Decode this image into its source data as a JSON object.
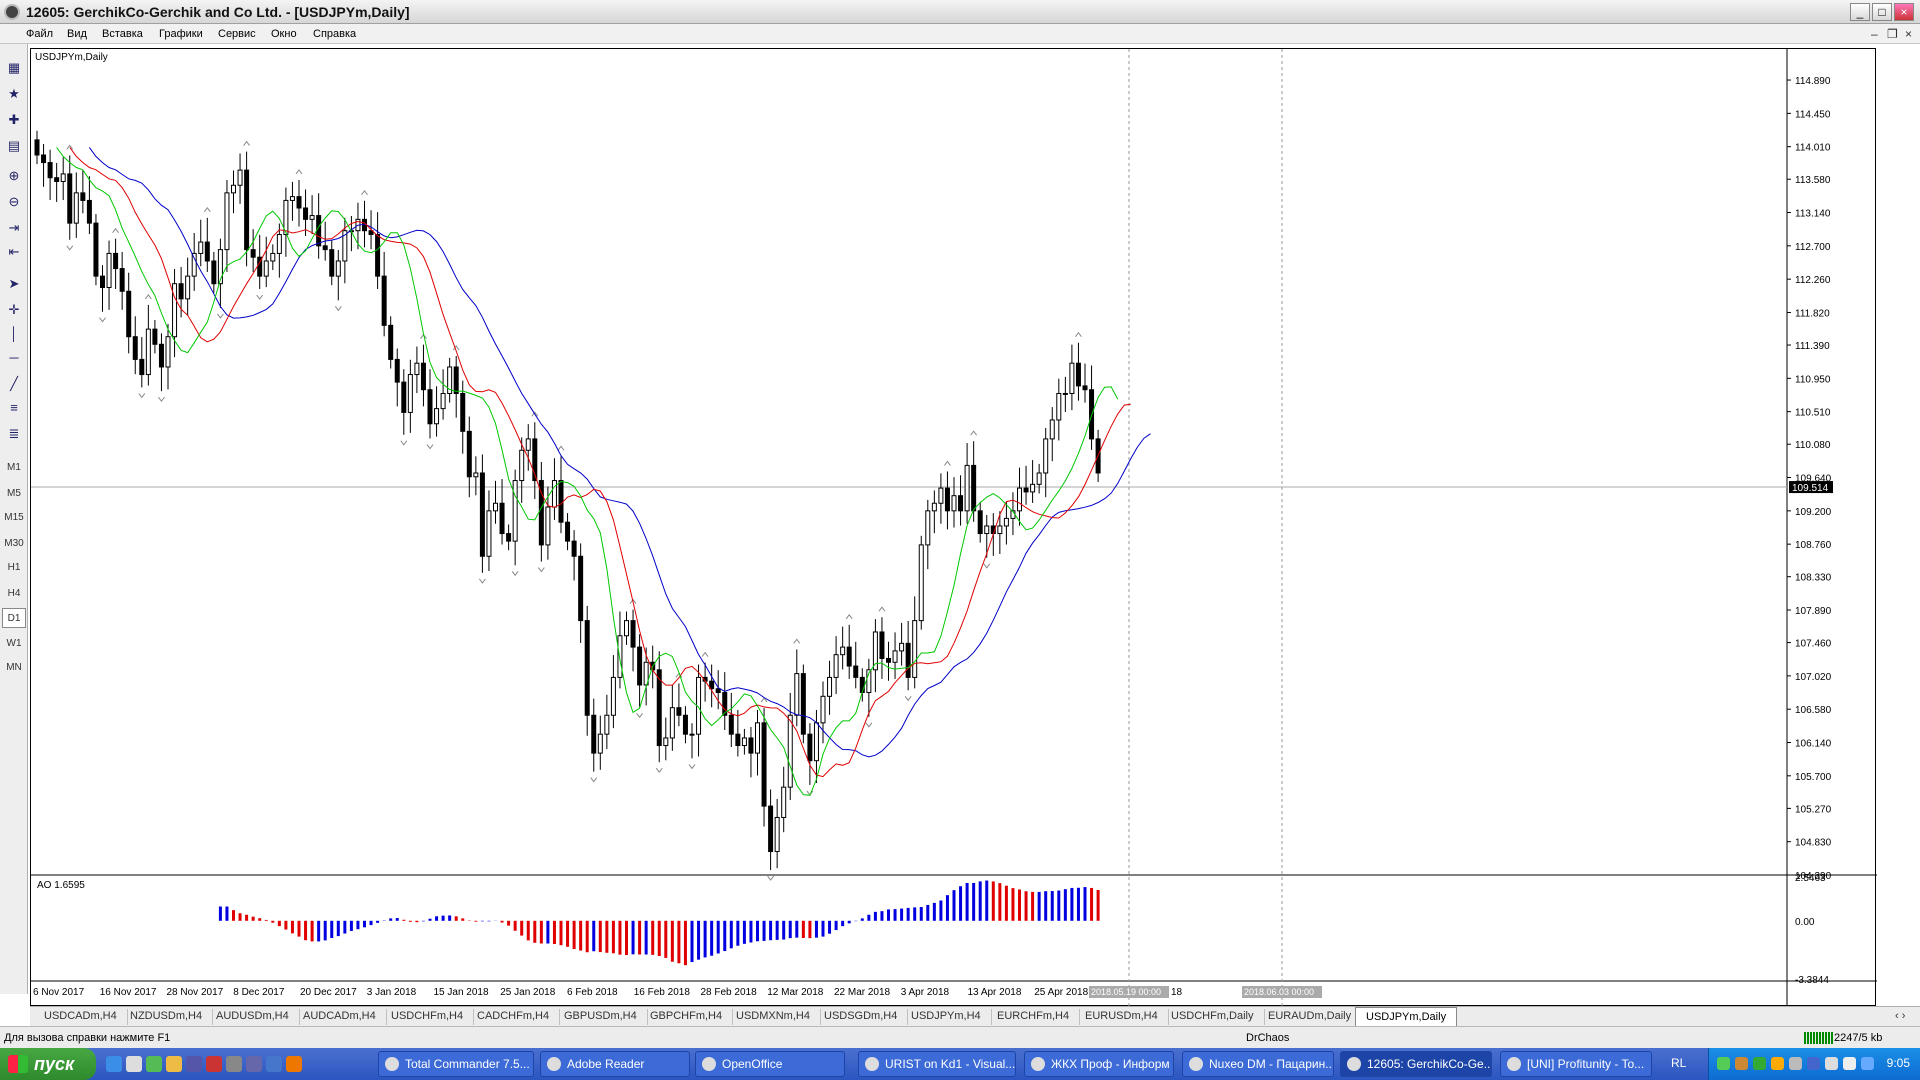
{
  "window": {
    "title": "12605: GerchikCo-Gerchik and Co Ltd. - [USDJPYm,Daily]",
    "btn_min": "_",
    "btn_max": "□",
    "btn_close": "×"
  },
  "menu": [
    "Файл",
    "Вид",
    "Вставка",
    "Графики",
    "Сервис",
    "Окно",
    "Справка"
  ],
  "toolbar": {
    "timeframes": [
      "M1",
      "M5",
      "M15",
      "M30",
      "H1",
      "H4",
      "D1",
      "W1",
      "MN"
    ],
    "active": "D1"
  },
  "chart": {
    "label": "USDJPYm,Daily",
    "price_ticks": [
      "114.890",
      "114.450",
      "114.010",
      "113.580",
      "113.140",
      "112.700",
      "112.260",
      "111.820",
      "111.390",
      "110.950",
      "110.510",
      "110.080",
      "109.640",
      "109.200",
      "108.760",
      "108.330",
      "107.890",
      "107.460",
      "107.020",
      "106.580",
      "106.140",
      "105.700",
      "105.270",
      "104.830",
      "104.390"
    ],
    "current_price": "109.514",
    "indicator": {
      "label": "AO 1.6595",
      "ticks": [
        "2.5463",
        "0.00",
        "-3.3844"
      ]
    },
    "date_labels": [
      "6 Nov 2017",
      "16 Nov 2017",
      "28 Nov 2017",
      "8 Dec 2017",
      "20 Dec 2017",
      "3 Jan 2018",
      "15 Jan 2018",
      "25 Jan 2018",
      "6 Feb 2018",
      "16 Feb 2018",
      "28 Feb 2018",
      "12 Mar 2018",
      "22 Mar 2018",
      "3 Apr 2018",
      "13 Apr 2018",
      "25 Apr 2018",
      "7 May 2"
    ],
    "vline_labels": [
      "2018.05.19 00:00",
      "2018.06.03 00:00"
    ],
    "vline_suffix": "18",
    "colors": {
      "green": "#00c800",
      "red": "#e00000",
      "blue": "#0000c8",
      "ao_up": "#0000e0",
      "ao_down": "#e00000"
    }
  },
  "chart_data": {
    "type": "candlestick",
    "symbol": "USDJPYm",
    "timeframe": "Daily",
    "ylim": [
      104.39,
      115.3
    ],
    "close": [
      113.9,
      113.8,
      113.6,
      113.55,
      113.65,
      113.0,
      113.4,
      113.3,
      113.0,
      112.3,
      112.15,
      112.6,
      112.4,
      112.1,
      111.5,
      111.2,
      111.0,
      111.6,
      111.4,
      111.1,
      111.5,
      112.2,
      112.0,
      112.3,
      112.6,
      112.75,
      112.5,
      112.2,
      112.65,
      113.4,
      113.5,
      113.7,
      112.65,
      112.55,
      112.3,
      112.5,
      112.6,
      112.85,
      113.3,
      113.35,
      113.2,
      113.05,
      113.1,
      112.7,
      112.65,
      112.3,
      112.5,
      112.9,
      112.9,
      113.05,
      112.9,
      112.85,
      112.3,
      111.65,
      111.2,
      110.9,
      110.5,
      111.0,
      111.15,
      110.8,
      110.35,
      110.55,
      110.75,
      111.1,
      110.75,
      110.25,
      109.65,
      109.7,
      108.6,
      109.2,
      109.3,
      108.9,
      108.8,
      109.6,
      110.0,
      110.15,
      109.6,
      108.75,
      109.25,
      109.6,
      109.05,
      108.8,
      108.6,
      107.75,
      106.5,
      106.0,
      106.25,
      106.5,
      107.0,
      107.55,
      107.75,
      107.4,
      106.9,
      107.2,
      107.1,
      106.1,
      106.2,
      106.6,
      106.5,
      106.25,
      106.25,
      107.0,
      106.95,
      106.85,
      106.8,
      106.5,
      106.25,
      106.1,
      106.2,
      106.0,
      106.4,
      105.3,
      104.7,
      105.15,
      105.55,
      106.5,
      107.05,
      106.25,
      105.9,
      106.4,
      106.75,
      107.0,
      107.3,
      107.4,
      107.15,
      107.0,
      106.8,
      107.1,
      107.6,
      107.25,
      107.2,
      107.35,
      107.45,
      107.0,
      107.75,
      108.75,
      109.2,
      109.3,
      109.5,
      109.2,
      109.4,
      109.2,
      109.8,
      109.2,
      108.9,
      109.0,
      108.9,
      109.0,
      109.1,
      109.2,
      109.5,
      109.45,
      109.55,
      109.7,
      110.15,
      110.4,
      110.75,
      110.75,
      111.15,
      110.85,
      110.8,
      110.15,
      109.7
    ],
    "ao": [
      0.83,
      0.83,
      0.62,
      0.44,
      0.35,
      0.24,
      0.15,
      0.05,
      -0.11,
      -0.31,
      -0.51,
      -0.73,
      -0.92,
      -1.13,
      -1.2,
      -1.2,
      -1.14,
      -1.0,
      -0.89,
      -0.74,
      -0.59,
      -0.49,
      -0.38,
      -0.25,
      -0.12,
      0.02,
      0.14,
      0.16,
      0.06,
      -0.06,
      -0.08,
      -0.03,
      0.12,
      0.26,
      0.3,
      0.31,
      0.26,
      0.14,
      0.02,
      -0.05,
      -0.03,
      -0.03,
      -0.01,
      -0.1,
      -0.28,
      -0.58,
      -0.86,
      -1.14,
      -1.28,
      -1.32,
      -1.32,
      -1.35,
      -1.42,
      -1.51,
      -1.64,
      -1.73,
      -1.83,
      -1.77,
      -1.82,
      -1.86,
      -1.89,
      -1.97,
      -1.99,
      -1.95,
      -1.96,
      -1.96,
      -1.98,
      -2.05,
      -2.16,
      -2.38,
      -2.47,
      -2.58,
      -2.4,
      -2.26,
      -2.13,
      -2.03,
      -1.9,
      -1.76,
      -1.6,
      -1.45,
      -1.34,
      -1.26,
      -1.19,
      -1.17,
      -1.13,
      -1.11,
      -1.09,
      -1.01,
      -0.98,
      -1.0,
      -1.01,
      -0.98,
      -0.92,
      -0.75,
      -0.54,
      -0.31,
      -0.15,
      -0.02,
      0.14,
      0.35,
      0.52,
      0.56,
      0.66,
      0.68,
      0.71,
      0.75,
      0.78,
      0.8,
      0.92,
      1.04,
      1.18,
      1.49,
      1.78,
      2.01,
      2.2,
      2.2,
      2.29,
      2.34,
      2.29,
      2.19,
      2.04,
      1.9,
      1.82,
      1.72,
      1.68,
      1.68,
      1.72,
      1.73,
      1.76,
      1.84,
      1.91,
      1.92,
      1.96,
      1.91,
      1.79
    ]
  },
  "tabs": [
    "USDCADm,H4",
    "NZDUSDm,H4",
    "AUDUSDm,H4",
    "AUDCADm,H4",
    "USDCHFm,H4",
    "CADCHFm,H4",
    "GBPUSDm,H4",
    "GBPCHFm,H4",
    "USDMXNm,H4",
    "USDSGDm,H4",
    "USDJPYm,H4",
    "EURCHFm,H4",
    "EURUSDm,H4",
    "USDCHFm,Daily",
    "EURAUDm,Daily",
    "USDJPYm,Daily"
  ],
  "active_tab": "USDJPYm,Daily",
  "status": {
    "help": "Для вызова справки нажмите F1",
    "profile": "DrChaos",
    "traffic": "2247/5 kb"
  },
  "taskbar": {
    "start": "пуск",
    "tasks": [
      "Total Commander 7.5...",
      "Adobe Reader",
      "OpenOffice",
      "URIST on Kd1 - Visual...",
      "ЖКХ Проф - Информ ©",
      "Nuxeo DM - Пацарин...",
      "12605: GerchikCo-Ge...",
      "[UNI] Profitunity - To..."
    ],
    "active_task": "12605: GerchikCo-Ge...",
    "lang": "RL",
    "time": "9:05"
  }
}
